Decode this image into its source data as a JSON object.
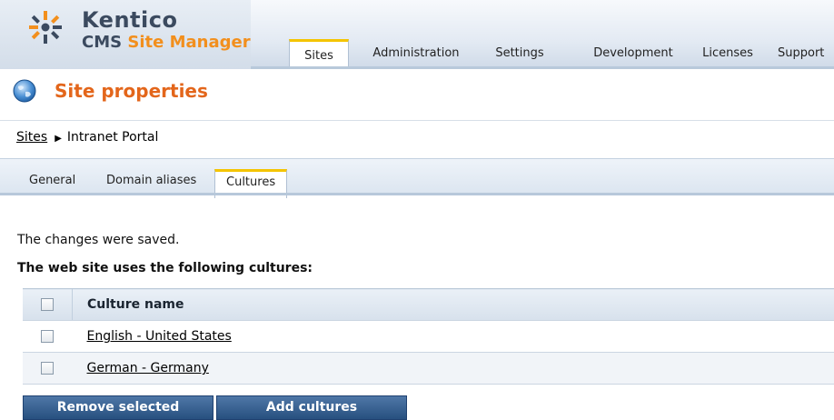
{
  "logo": {
    "brand": "Kentico",
    "product_prefix": "CMS",
    "product_name": "Site Manager"
  },
  "top_tabs": [
    {
      "label": "Sites",
      "active": true
    },
    {
      "label": "Administration",
      "active": false
    },
    {
      "label": "Settings",
      "active": false
    },
    {
      "label": "Development",
      "active": false
    },
    {
      "label": "Licenses",
      "active": false
    },
    {
      "label": "Support",
      "active": false
    }
  ],
  "page": {
    "title": "Site properties",
    "icon": "globe-icon"
  },
  "breadcrumb": {
    "root": "Sites",
    "current": "Intranet Portal"
  },
  "sub_tabs": [
    {
      "label": "General",
      "active": false
    },
    {
      "label": "Domain aliases",
      "active": false
    },
    {
      "label": "Cultures",
      "active": true
    }
  ],
  "content": {
    "status_message": "The changes were saved.",
    "section_title": "The web site uses the following cultures:"
  },
  "grid": {
    "header": "Culture name",
    "rows": [
      {
        "name": "English - United States",
        "checked": false
      },
      {
        "name": "German - Germany",
        "checked": false
      }
    ]
  },
  "buttons": {
    "remove_selected": "Remove selected",
    "add_cultures": "Add cultures"
  },
  "colors": {
    "accent_orange": "#e3661b",
    "tab_highlight": "#f4c400",
    "button_blue": "#27507f"
  }
}
